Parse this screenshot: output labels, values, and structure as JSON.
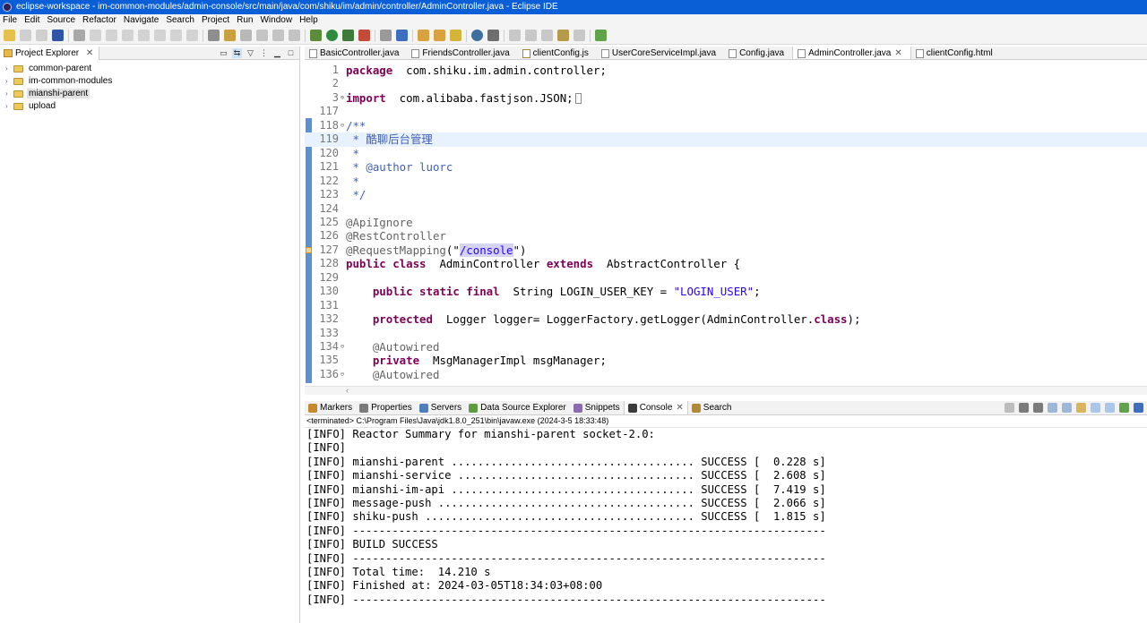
{
  "window": {
    "title": "eclipse-workspace - im-common-modules/admin-console/src/main/java/com/shiku/im/admin/controller/AdminController.java - Eclipse IDE"
  },
  "menu": [
    "File",
    "Edit",
    "Source",
    "Refactor",
    "Navigate",
    "Search",
    "Project",
    "Run",
    "Window",
    "Help"
  ],
  "explorer": {
    "tab_label": "Project Explorer",
    "items": [
      {
        "label": "common-parent"
      },
      {
        "label": "im-common-modules"
      },
      {
        "label": "mianshi-parent",
        "selected": true
      },
      {
        "label": "upload"
      }
    ]
  },
  "editor": {
    "tabs": [
      {
        "label": "BasicController.java",
        "icon": "java-file-icon"
      },
      {
        "label": "FriendsController.java",
        "icon": "java-file-icon"
      },
      {
        "label": "clientConfig.js",
        "icon": "js-file-icon"
      },
      {
        "label": "UserCoreServiceImpl.java",
        "icon": "java-file-icon"
      },
      {
        "label": "Config.java",
        "icon": "java-file-icon"
      },
      {
        "label": "AdminController.java",
        "icon": "java-file-icon",
        "active": true
      },
      {
        "label": "clientConfig.html",
        "icon": "html-file-icon"
      }
    ],
    "current_line": "119",
    "lines": [
      {
        "num": "1",
        "fold": "",
        "segs": [
          [
            "kw",
            "package"
          ],
          [
            "",
            "  com.shiku.im.admin.controller;"
          ]
        ]
      },
      {
        "num": "2",
        "fold": "",
        "segs": []
      },
      {
        "num": "3",
        "fold": "⊕",
        "segs": [
          [
            "kw",
            "import"
          ],
          [
            "",
            "  com.alibaba.fastjson.JSON;"
          ]
        ]
      },
      {
        "num": "117",
        "fold": "",
        "segs": []
      },
      {
        "num": "118",
        "fold": "⊖",
        "segs": [
          [
            "cmt",
            "/**"
          ]
        ]
      },
      {
        "num": "119",
        "fold": "",
        "segs": [
          [
            "cmt",
            " * 酷聊后台管理"
          ]
        ]
      },
      {
        "num": "120",
        "fold": "",
        "segs": [
          [
            "cmt",
            " *"
          ]
        ]
      },
      {
        "num": "121",
        "fold": "",
        "segs": [
          [
            "cmt",
            " * @author luorc"
          ]
        ]
      },
      {
        "num": "122",
        "fold": "",
        "segs": [
          [
            "cmt",
            " *"
          ]
        ]
      },
      {
        "num": "123",
        "fold": "",
        "segs": [
          [
            "cmt",
            " */"
          ]
        ]
      },
      {
        "num": "124",
        "fold": "",
        "segs": []
      },
      {
        "num": "125",
        "fold": "",
        "segs": [
          [
            "ann",
            "@ApiIgnore"
          ]
        ]
      },
      {
        "num": "126",
        "fold": "",
        "segs": [
          [
            "ann",
            "@RestController"
          ]
        ]
      },
      {
        "num": "127",
        "fold": "",
        "marker": true,
        "segs": [
          [
            "ann",
            "@RequestMapping"
          ],
          [
            "",
            "(\""
          ],
          [
            "str hl",
            "/console"
          ],
          [
            "",
            "\")"
          ]
        ]
      },
      {
        "num": "128",
        "fold": "",
        "segs": [
          [
            "kw",
            "public class"
          ],
          [
            "",
            "  AdminController "
          ],
          [
            "kw",
            "extends"
          ],
          [
            "",
            "  AbstractController {"
          ]
        ]
      },
      {
        "num": "129",
        "fold": "",
        "segs": []
      },
      {
        "num": "130",
        "fold": "",
        "segs": [
          [
            "",
            "    "
          ],
          [
            "kw",
            "public static final"
          ],
          [
            "",
            "  String LOGIN_USER_KEY = "
          ],
          [
            "str",
            "\"LOGIN_USER\""
          ],
          [
            "",
            ";"
          ]
        ]
      },
      {
        "num": "131",
        "fold": "",
        "segs": []
      },
      {
        "num": "132",
        "fold": "",
        "segs": [
          [
            "",
            "    "
          ],
          [
            "kw",
            "protected"
          ],
          [
            "",
            "  Logger logger= LoggerFactory.getLogger(AdminController."
          ],
          [
            "kw",
            "class"
          ],
          [
            "",
            ");"
          ]
        ]
      },
      {
        "num": "133",
        "fold": "",
        "segs": []
      },
      {
        "num": "134",
        "fold": "⊖",
        "segs": [
          [
            "",
            "    "
          ],
          [
            "ann",
            "@Autowired"
          ]
        ]
      },
      {
        "num": "135",
        "fold": "",
        "segs": [
          [
            "",
            "    "
          ],
          [
            "kw",
            "private"
          ],
          [
            "",
            "  MsgManagerImpl msgManager;"
          ]
        ]
      },
      {
        "num": "136",
        "fold": "⊖",
        "segs": [
          [
            "",
            "    "
          ],
          [
            "ann",
            "@Autowired"
          ]
        ]
      }
    ]
  },
  "console": {
    "tabs": [
      {
        "label": "Markers",
        "color": "#c58a2a"
      },
      {
        "label": "Properties",
        "color": "#7a7a7a"
      },
      {
        "label": "Servers",
        "color": "#4d7fb8"
      },
      {
        "label": "Data Source Explorer",
        "color": "#5e9c3f"
      },
      {
        "label": "Snippets",
        "color": "#8a6bb0"
      },
      {
        "label": "Console",
        "color": "#3b3b3b",
        "active": true
      },
      {
        "label": "Search",
        "color": "#b08a3a"
      }
    ],
    "terminated": "<terminated> C:\\Program Files\\Java\\jdk1.8.0_251\\bin\\javaw.exe (2024-3-5 18:33:48)",
    "lines": [
      "[INFO] Reactor Summary for mianshi-parent socket-2.0:",
      "[INFO]",
      "[INFO] mianshi-parent ..................................... SUCCESS [  0.228 s]",
      "[INFO] mianshi-service .................................... SUCCESS [  2.608 s]",
      "[INFO] mianshi-im-api ..................................... SUCCESS [  7.419 s]",
      "[INFO] message-push ....................................... SUCCESS [  2.066 s]",
      "[INFO] shiku-push ......................................... SUCCESS [  1.815 s]",
      "[INFO] ------------------------------------------------------------------------",
      "[INFO] BUILD SUCCESS",
      "[INFO] ------------------------------------------------------------------------",
      "[INFO] Total time:  14.210 s",
      "[INFO] Finished at: 2024-03-05T18:34:03+08:00",
      "[INFO] ------------------------------------------------------------------------"
    ]
  },
  "colors": {
    "title_bar": "#0b5fd6",
    "keyword": "#7f0055",
    "string": "#2a00ff",
    "javadoc": "#3f5fbf",
    "annotation": "#646464"
  }
}
